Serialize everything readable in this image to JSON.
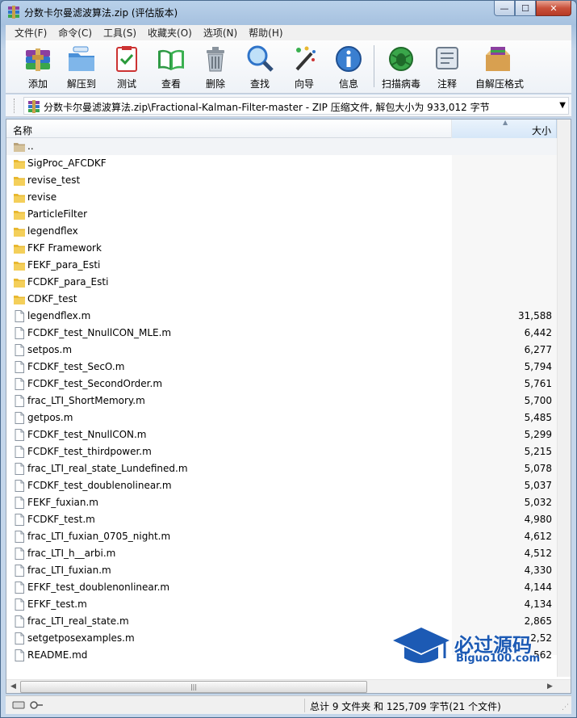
{
  "window": {
    "title": "分数卡尔曼滤波算法.zip (评估版本)",
    "controls": {
      "minimize": "—",
      "maximize": "☐",
      "close": "✕"
    }
  },
  "menu": [
    "文件(F)",
    "命令(C)",
    "工具(S)",
    "收藏夹(O)",
    "选项(N)",
    "帮助(H)"
  ],
  "toolbar": [
    {
      "label": "添加",
      "icon": "add-archive-icon"
    },
    {
      "label": "解压到",
      "icon": "extract-to-icon"
    },
    {
      "label": "测试",
      "icon": "test-icon"
    },
    {
      "label": "查看",
      "icon": "view-book-icon"
    },
    {
      "label": "删除",
      "icon": "delete-trash-icon"
    },
    {
      "label": "查找",
      "icon": "find-magnifier-icon"
    },
    {
      "label": "向导",
      "icon": "wizard-wand-icon"
    },
    {
      "label": "信息",
      "icon": "info-icon"
    },
    {
      "label": "扫描病毒",
      "icon": "virus-scan-icon"
    },
    {
      "label": "注释",
      "icon": "comment-icon"
    },
    {
      "label": "自解压格式",
      "icon": "sfx-icon"
    }
  ],
  "address": {
    "path": "分数卡尔曼滤波算法.zip\\Fractional-Kalman-Filter-master - ZIP 压缩文件, 解包大小为 933,012 字节"
  },
  "columns": {
    "name": "名称",
    "size": "大小"
  },
  "files": [
    {
      "name": "..",
      "size": "",
      "type": "up"
    },
    {
      "name": "SigProc_AFCDKF",
      "size": "",
      "type": "folder"
    },
    {
      "name": "revise_test",
      "size": "",
      "type": "folder"
    },
    {
      "name": "revise",
      "size": "",
      "type": "folder"
    },
    {
      "name": "ParticleFilter",
      "size": "",
      "type": "folder"
    },
    {
      "name": "legendflex",
      "size": "",
      "type": "folder"
    },
    {
      "name": "FKF Framework",
      "size": "",
      "type": "folder"
    },
    {
      "name": "FEKF_para_Esti",
      "size": "",
      "type": "folder"
    },
    {
      "name": "FCDKF_para_Esti",
      "size": "",
      "type": "folder"
    },
    {
      "name": "CDKF_test",
      "size": "",
      "type": "folder"
    },
    {
      "name": "legendflex.m",
      "size": "31,588",
      "type": "file"
    },
    {
      "name": "FCDKF_test_NnullCON_MLE.m",
      "size": "6,442",
      "type": "file"
    },
    {
      "name": "setpos.m",
      "size": "6,277",
      "type": "file"
    },
    {
      "name": "FCDKF_test_SecO.m",
      "size": "5,794",
      "type": "file"
    },
    {
      "name": "FCDKF_test_SecondOrder.m",
      "size": "5,761",
      "type": "file"
    },
    {
      "name": "frac_LTI_ShortMemory.m",
      "size": "5,700",
      "type": "file"
    },
    {
      "name": "getpos.m",
      "size": "5,485",
      "type": "file"
    },
    {
      "name": "FCDKF_test_NnullCON.m",
      "size": "5,299",
      "type": "file"
    },
    {
      "name": "FCDKF_test_thirdpower.m",
      "size": "5,215",
      "type": "file"
    },
    {
      "name": "frac_LTI_real_state_Lundefined.m",
      "size": "5,078",
      "type": "file"
    },
    {
      "name": "FCDKF_test_doublenolinear.m",
      "size": "5,037",
      "type": "file"
    },
    {
      "name": "FEKF_fuxian.m",
      "size": "5,032",
      "type": "file"
    },
    {
      "name": "FCDKF_test.m",
      "size": "4,980",
      "type": "file"
    },
    {
      "name": "frac_LTI_fuxian_0705_night.m",
      "size": "4,612",
      "type": "file"
    },
    {
      "name": "frac_LTI_h__arbi.m",
      "size": "4,512",
      "type": "file"
    },
    {
      "name": "frac_LTI_fuxian.m",
      "size": "4,330",
      "type": "file"
    },
    {
      "name": "EFKF_test_doublenonlinear.m",
      "size": "4,144",
      "type": "file"
    },
    {
      "name": "EFKF_test.m",
      "size": "4,134",
      "type": "file"
    },
    {
      "name": "frac_LTI_real_state.m",
      "size": "2,865",
      "type": "file"
    },
    {
      "name": "setgetposexamples.m",
      "size": "2,52",
      "type": "file"
    },
    {
      "name": "README.md",
      "size": "562",
      "type": "file"
    }
  ],
  "status": {
    "summary": "总计 9 文件夹 和 125,709 字节(21 个文件)"
  },
  "watermark": {
    "text": "必过源码",
    "sub": "Biguo100.com"
  },
  "colors": {
    "folder": "#e8b830",
    "accent": "#1c5ab4",
    "titlebar": "#b9d1ea"
  }
}
